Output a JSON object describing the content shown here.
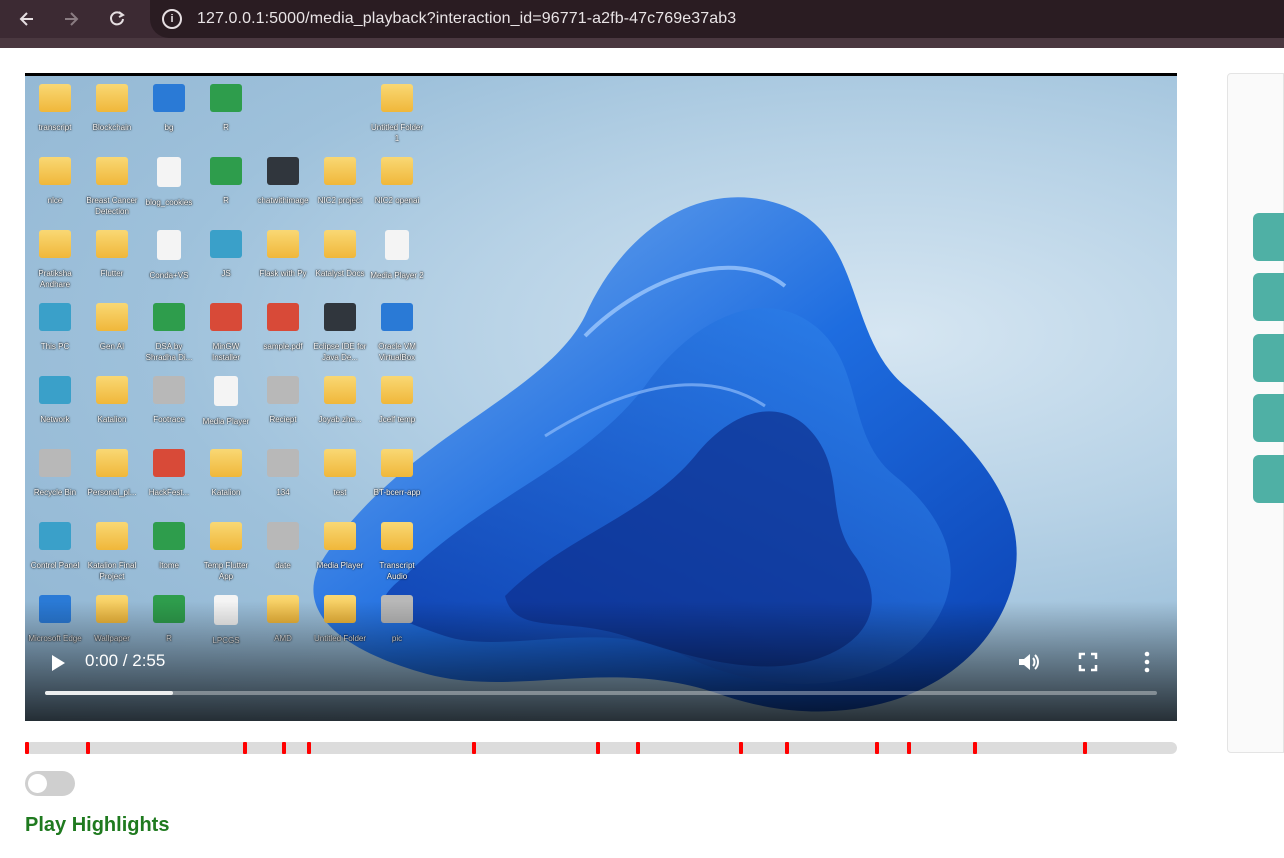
{
  "browser": {
    "url": "127.0.0.1:5000/media_playback?interaction_id=96771-a2fb-47c769e37ab3",
    "back_icon": "back-arrow-icon",
    "forward_icon": "forward-arrow-icon",
    "reload_icon": "reload-icon",
    "site_info_icon": "info-icon"
  },
  "video": {
    "time_display": "0:00 / 2:55",
    "current_time": "0:00",
    "duration": "2:55",
    "buffered_fraction": 0.115,
    "controls": {
      "play_icon": "play-icon",
      "volume_icon": "volume-icon",
      "fullscreen_icon": "fullscreen-icon",
      "more_icon": "more-vertical-icon"
    },
    "desktop_icons": [
      {
        "label": "transcript",
        "kind": "folder"
      },
      {
        "label": "Blockchain",
        "kind": "folder"
      },
      {
        "label": "bg",
        "kind": "blue"
      },
      {
        "label": "R",
        "kind": "green"
      },
      {
        "label": "Untitled Folder 1",
        "kind": "folder"
      },
      {
        "label": "nlce",
        "kind": "folder"
      },
      {
        "label": "Breast Cancer Detection",
        "kind": "folder"
      },
      {
        "label": "blog_cookies",
        "kind": "doc"
      },
      {
        "label": "R",
        "kind": "green"
      },
      {
        "label": "chatwithimage",
        "kind": "dark"
      },
      {
        "label": "NIC2 project",
        "kind": "folder"
      },
      {
        "label": "NIC2 openai",
        "kind": "folder"
      },
      {
        "label": "Pratiksha Andhare",
        "kind": "folder"
      },
      {
        "label": "Flutter",
        "kind": "folder"
      },
      {
        "label": "Conda+VS",
        "kind": "doc"
      },
      {
        "label": "JS",
        "kind": "teal"
      },
      {
        "label": "Flask with Py",
        "kind": "folder"
      },
      {
        "label": "Katalyst Docs",
        "kind": "folder"
      },
      {
        "label": "Media Player 2",
        "kind": "doc"
      },
      {
        "label": "This PC",
        "kind": "teal"
      },
      {
        "label": "Gen AI",
        "kind": "folder"
      },
      {
        "label": "DSA by Shradha Di...",
        "kind": "green"
      },
      {
        "label": "MinGW Installer",
        "kind": "red"
      },
      {
        "label": "sample.pdf",
        "kind": "red"
      },
      {
        "label": "Eclipse IDE for Java De...",
        "kind": "dark"
      },
      {
        "label": "Oracle VM VirtualBox",
        "kind": "blue"
      },
      {
        "label": "Network",
        "kind": "teal"
      },
      {
        "label": "Katalion",
        "kind": "folder"
      },
      {
        "label": "Footrace",
        "kind": "gray"
      },
      {
        "label": "Media Player",
        "kind": "doc"
      },
      {
        "label": "Reciept",
        "kind": "gray"
      },
      {
        "label": "Joyab zhe...",
        "kind": "folder"
      },
      {
        "label": "Jcelf temp",
        "kind": "folder"
      },
      {
        "label": "Recycle Bin",
        "kind": "gray"
      },
      {
        "label": "Personal_pl...",
        "kind": "folder"
      },
      {
        "label": "HackFest...",
        "kind": "red"
      },
      {
        "label": "Katalion",
        "kind": "folder"
      },
      {
        "label": "134",
        "kind": "gray"
      },
      {
        "label": "test",
        "kind": "folder"
      },
      {
        "label": "BT-bcerr-app",
        "kind": "folder"
      },
      {
        "label": "Control Panel",
        "kind": "teal"
      },
      {
        "label": "Katalion Final Project",
        "kind": "folder"
      },
      {
        "label": "Itome",
        "kind": "green"
      },
      {
        "label": "Temp Flutter App",
        "kind": "folder"
      },
      {
        "label": "date",
        "kind": "gray"
      },
      {
        "label": "Media Player",
        "kind": "folder"
      },
      {
        "label": "Transcript Audio",
        "kind": "folder"
      },
      {
        "label": "Microsoft Edge",
        "kind": "blue"
      },
      {
        "label": "Wallpaper",
        "kind": "folder"
      },
      {
        "label": "R",
        "kind": "green"
      },
      {
        "label": "LPCGS",
        "kind": "doc"
      },
      {
        "label": "AMD",
        "kind": "folder"
      },
      {
        "label": "Untitled Folder",
        "kind": "folder"
      },
      {
        "label": "pic",
        "kind": "gray"
      }
    ]
  },
  "highlights": {
    "marker_fractions": [
      0.0,
      0.053,
      0.19,
      0.224,
      0.246,
      0.389,
      0.497,
      0.532,
      0.622,
      0.662,
      0.74,
      0.768,
      0.826,
      0.922
    ],
    "toggle_on": false,
    "label": "Play Highlights",
    "marker_color": "#ff0000",
    "label_color": "#1f7a1f"
  },
  "side_panel": {
    "button_count": 5,
    "button_color": "#4fb0a5"
  }
}
